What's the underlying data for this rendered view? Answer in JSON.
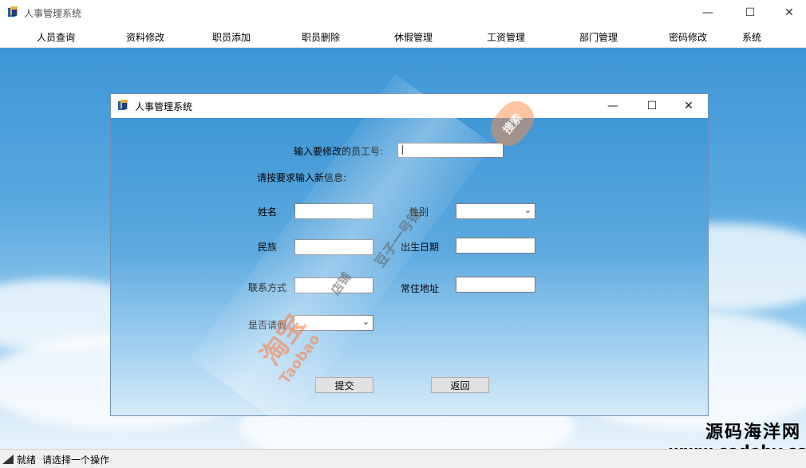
{
  "app": {
    "title": "人事管理系统"
  },
  "window_controls": {
    "minimize": "—",
    "maximize": "☐",
    "close": "✕"
  },
  "menu": {
    "items": [
      "人员查询",
      "资料修改",
      "职员添加",
      "职员删除",
      "休假管理",
      "工资管理",
      "部门管理",
      "密码修改",
      "系统"
    ]
  },
  "dialog": {
    "title": "人事管理系统",
    "employee_id_label": "输入要修改的员工号:",
    "employee_id_value": "",
    "instruction": "请按要求输入新信息:",
    "fields": {
      "name_label": "姓名",
      "gender_label": "性别",
      "ethnicity_label": "民族",
      "birthdate_label": "出生日期",
      "contact_label": "联系方式",
      "address_label": "常住地址",
      "leave_label": "是否请假"
    },
    "values": {
      "name": "",
      "gender": "",
      "ethnicity": "",
      "birthdate": "",
      "contact": "",
      "address": "",
      "leave": ""
    },
    "submit_label": "提交",
    "back_label": "返回"
  },
  "status": {
    "ready": "就绪",
    "hint": "请选择一个操作"
  },
  "watermark": {
    "brand_cn": "源码海洋网",
    "brand_url": "www.codehy.com",
    "taobao_cn": "淘宝",
    "taobao_en": "Taobao",
    "shop": "店铺",
    "shop_name": "豆子一号铺",
    "search": "搜索"
  },
  "colors": {
    "desktop_blue": "#3e96d6",
    "border": "#6b8fb5",
    "watermark_orange": "#ff7a3c"
  }
}
